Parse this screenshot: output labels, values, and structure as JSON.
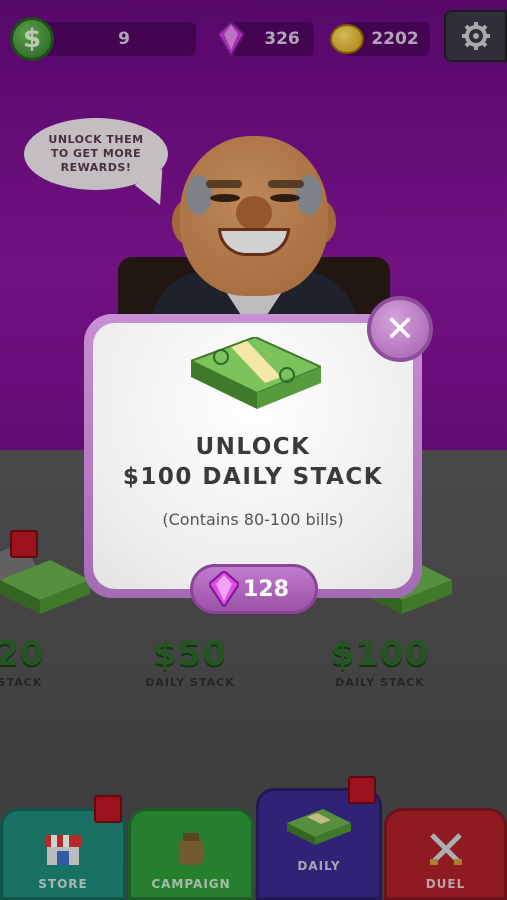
{
  "topbar": {
    "cash_symbol": "$",
    "cash_value": "9",
    "gems_value": "326",
    "coins_value": "2202"
  },
  "bubble": {
    "text": "UNLOCK THEM TO GET MORE REWARDS!"
  },
  "stacks": [
    {
      "price": "20",
      "label": "STACK"
    },
    {
      "price": "$50",
      "label": "DAILY STACK"
    },
    {
      "price": "$100",
      "label": "DAILY STACK"
    }
  ],
  "modal": {
    "title_line1": "UNLOCK",
    "title_line2": "$100 DAILY STACK",
    "description": "(Contains 80-100 bills)",
    "price": "128",
    "close": "✕"
  },
  "tabs": [
    {
      "label": "STORE",
      "color": "#1f8a7a",
      "icon": "store-icon"
    },
    {
      "label": "CAMPAIGN",
      "color": "#2f9a3a",
      "icon": "money-bag-icon"
    },
    {
      "label": "DAILY",
      "color": "#3b2a8e",
      "icon": "cash-stack-icon"
    },
    {
      "label": "DUEL",
      "color": "#b0202a",
      "icon": "crossed-swords-icon"
    }
  ],
  "colors": {
    "gem": "#c838d8",
    "cash_green": "#2e6a2a",
    "badge_red": "#c01626"
  }
}
